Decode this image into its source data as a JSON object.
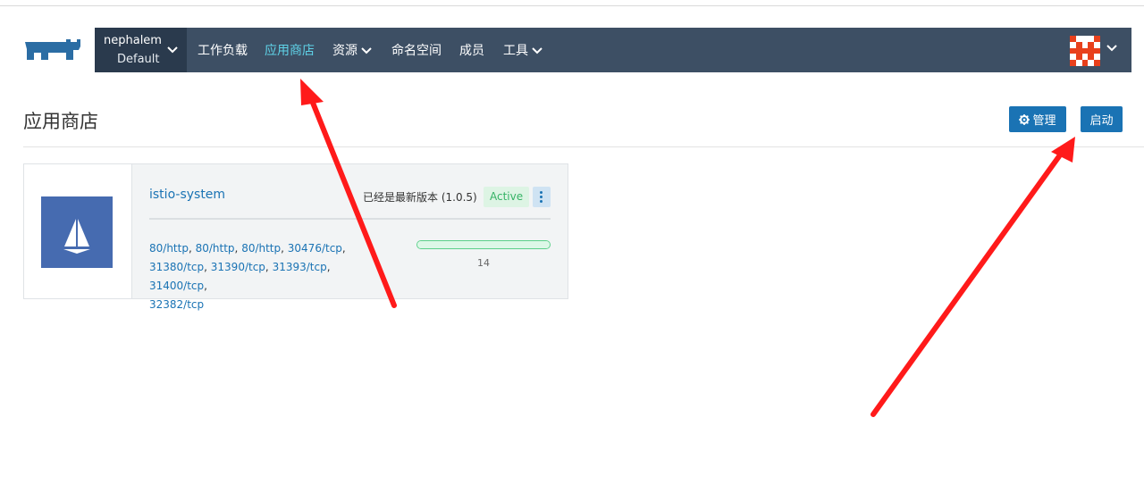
{
  "header": {
    "cluster": "nephalem",
    "project": "Default",
    "nav": [
      {
        "label": "工作负载",
        "active": false,
        "dropdown": false
      },
      {
        "label": "应用商店",
        "active": true,
        "dropdown": false
      },
      {
        "label": "资源",
        "active": false,
        "dropdown": true
      },
      {
        "label": "命名空间",
        "active": false,
        "dropdown": false
      },
      {
        "label": "成员",
        "active": false,
        "dropdown": false
      },
      {
        "label": "工具",
        "active": false,
        "dropdown": true
      }
    ]
  },
  "page": {
    "title": "应用商店",
    "manage_label": "管理",
    "launch_label": "启动"
  },
  "app": {
    "name": "istio-system",
    "version_text": "已经是最新版本 (1.0.5)",
    "status": "Active",
    "endpoints": [
      "80/http",
      "80/http",
      "80/http",
      "30476/tcp",
      "31380/tcp",
      "31390/tcp",
      "31393/tcp",
      "31400/tcp",
      "32382/tcp"
    ],
    "pod_count": "14"
  },
  "colors": {
    "navbar": "#3d4f64",
    "env_switcher": "#2a3a4d",
    "accent": "#1a73b4",
    "active_nav": "#5fd3e8",
    "active_badge": "#36b366",
    "annotation_arrow": "#ff0000"
  },
  "icons": {
    "logo": "rancher-cow-logo",
    "app": "istio-sail-icon",
    "manage": "gear-icon",
    "menu": "kebab-icon"
  }
}
